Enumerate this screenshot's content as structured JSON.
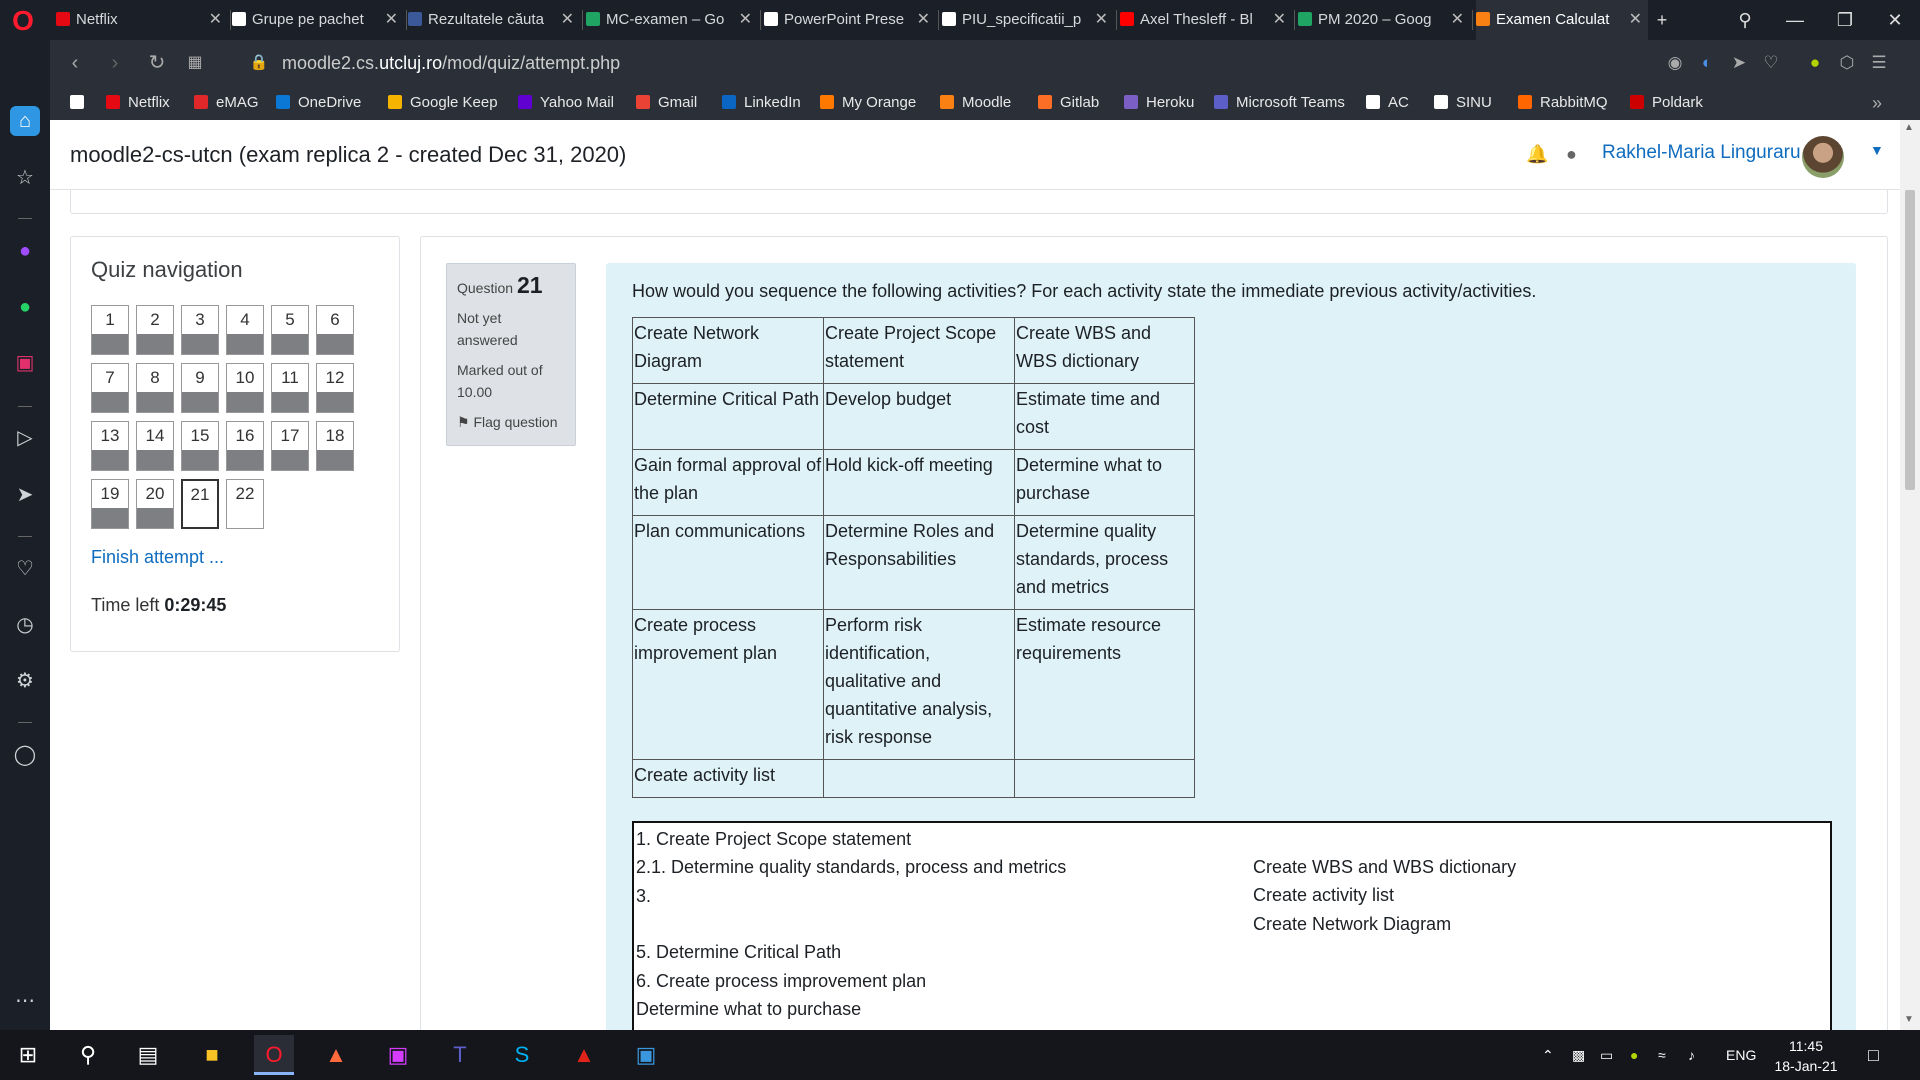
{
  "browser": {
    "tabs": [
      {
        "label": "Netflix",
        "icon": "netflix-icon",
        "color": "#e50914"
      },
      {
        "label": "Grupe pe pachet",
        "icon": "doc-icon",
        "color": "#ffffff"
      },
      {
        "label": "Rezultatele căuta",
        "icon": "site-icon",
        "color": "#3b5998"
      },
      {
        "label": "MC-examen – Go",
        "icon": "drive-icon",
        "color": "#1fa463"
      },
      {
        "label": "PowerPoint Prese",
        "icon": "doc-icon",
        "color": "#ffffff"
      },
      {
        "label": "PIU_specificatii_p",
        "icon": "doc-icon",
        "color": "#ffffff"
      },
      {
        "label": "Axel Thesleff - Bl",
        "icon": "youtube-icon",
        "color": "#ff0000"
      },
      {
        "label": "PM 2020 – Goog",
        "icon": "drive-icon",
        "color": "#1fa463"
      },
      {
        "label": "Examen Calculat",
        "icon": "moodle-icon",
        "color": "#f98012"
      }
    ],
    "url_prefix": "moodle2.cs.",
    "url_domain": "utcluj.ro",
    "url_path": "/mod/quiz/attempt.php",
    "bookmarks": [
      {
        "label": "Netflix",
        "color": "#e50914"
      },
      {
        "label": "eMAG",
        "color": "#e0282b"
      },
      {
        "label": "OneDrive",
        "color": "#0a78d4"
      },
      {
        "label": "Google Keep",
        "color": "#f6b400"
      },
      {
        "label": "Yahoo Mail",
        "color": "#6001d2"
      },
      {
        "label": "Gmail",
        "color": "#ea4335"
      },
      {
        "label": "LinkedIn",
        "color": "#0a66c2"
      },
      {
        "label": "My Orange",
        "color": "#ff7900"
      },
      {
        "label": "Moodle",
        "color": "#f98012"
      },
      {
        "label": "Gitlab",
        "color": "#fc6d26"
      },
      {
        "label": "Heroku",
        "color": "#7b5fc4"
      },
      {
        "label": "Microsoft Teams",
        "color": "#5b5fc7"
      },
      {
        "label": "AC",
        "color": "#ffffff"
      },
      {
        "label": "SINU",
        "color": "#ffffff"
      },
      {
        "label": "RabbitMQ",
        "color": "#ff6600"
      },
      {
        "label": "Poldark",
        "color": "#cc0000"
      }
    ]
  },
  "site": {
    "title": "moodle2-cs-utcn (exam replica 2 - created Dec 31, 2020)",
    "user_name": "Rakhel-Maria Linguraru"
  },
  "quiz_nav": {
    "heading": "Quiz navigation",
    "questions": [
      "1",
      "2",
      "3",
      "4",
      "5",
      "6",
      "7",
      "8",
      "9",
      "10",
      "11",
      "12",
      "13",
      "14",
      "15",
      "16",
      "17",
      "18",
      "19",
      "20",
      "21",
      "22"
    ],
    "finish_label": "Finish attempt ...",
    "time_label": "Time left",
    "time_value": "0:29:45"
  },
  "question": {
    "label": "Question",
    "number": "21",
    "status": "Not yet answered",
    "marks": "Marked out of 10.00",
    "flag_label": "Flag question",
    "prompt": "How would you sequence the following activities? For each activity state the immediate previous activity/activities.",
    "table_rows": [
      [
        "Create Network Diagram",
        "Create Project Scope statement",
        "Create WBS and WBS dictionary"
      ],
      [
        "Determine Critical Path",
        "Develop budget",
        "Estimate time and cost"
      ],
      [
        "Gain formal approval of the plan",
        "Hold kick-off meeting",
        "Determine what to purchase"
      ],
      [
        "Plan communications",
        "Determine Roles and Responsabilities",
        "Determine quality standards, process and metrics"
      ],
      [
        "Create process improvement plan",
        "Perform risk identification, qualitative and quantitative analysis, risk response",
        "Estimate resource requirements"
      ],
      [
        "Create activity list",
        "",
        ""
      ]
    ],
    "answer": {
      "left": [
        "1. Create Project Scope statement",
        "2.1. Determine quality standards, process and metrics",
        "3.",
        "",
        "5. Determine Critical Path",
        "6. Create process improvement plan",
        "Determine what to purchase"
      ],
      "right": [
        "Create WBS and WBS dictionary",
        "Create activity list",
        "Create Network Diagram"
      ]
    }
  },
  "taskbar": {
    "language": "ENG",
    "time": "11:45",
    "date": "18-Jan-21"
  }
}
